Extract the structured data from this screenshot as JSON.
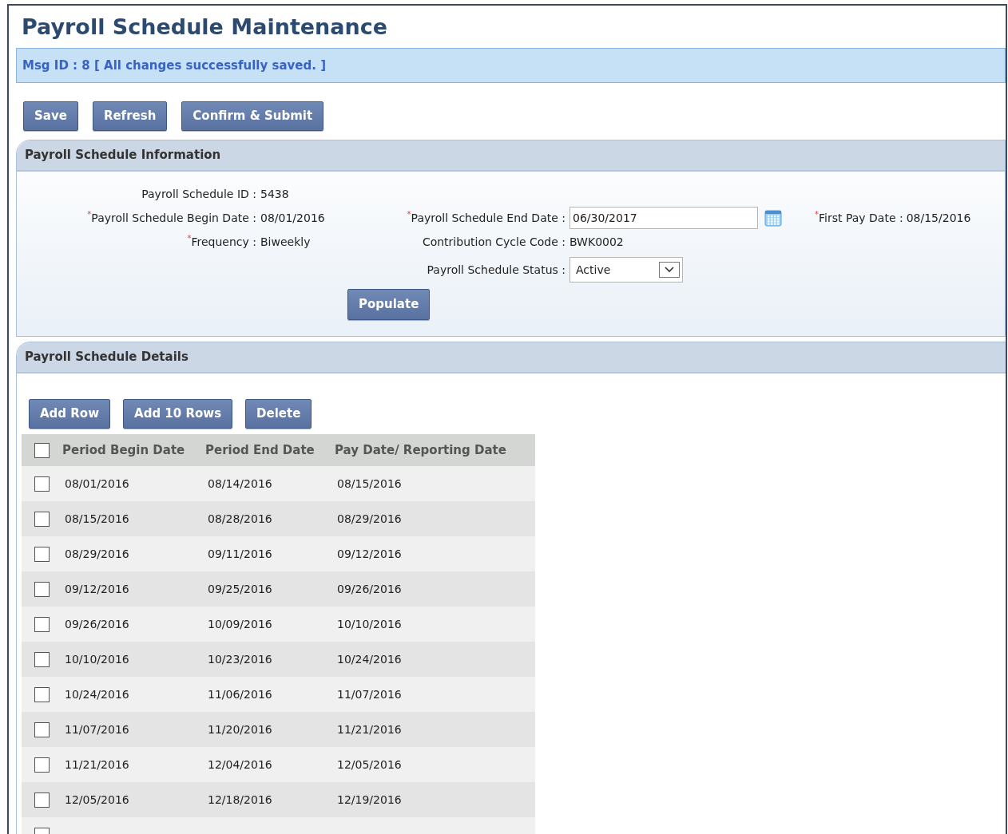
{
  "title": "Payroll Schedule Maintenance",
  "message": "Msg ID : 8 [ All changes successfully saved. ]",
  "toolbar": [
    "Save",
    "Refresh",
    "Confirm & Submit"
  ],
  "info_section": {
    "title": "Payroll Schedule Information",
    "fields": [
      {
        "kind": "text",
        "label": "Payroll Schedule ID :",
        "value": "5438"
      },
      {
        "kind": "text",
        "required_marker": "*",
        "label": "Payroll Schedule Begin Date :",
        "value": "08/01/2016"
      },
      {
        "kind": "date",
        "required_marker": "*",
        "label": "Payroll Schedule End Date :",
        "value": "06/30/2017"
      },
      {
        "kind": "text",
        "required_marker": "*",
        "label": "First Pay Date :",
        "value": "08/15/2016"
      },
      {
        "kind": "text",
        "required_marker": "*",
        "label": "Frequency :",
        "value": "Biweekly"
      },
      {
        "kind": "text",
        "label": "Contribution Cycle Code :",
        "value": "BWK0002"
      },
      {
        "kind": "select",
        "label": "Payroll Schedule Status :",
        "value": "Active"
      }
    ],
    "button": "Populate"
  },
  "details_section": {
    "title": "Payroll Schedule Details",
    "buttons": [
      "Add Row",
      "Add 10 Rows",
      "Delete"
    ],
    "table": {
      "select_all_checked": false,
      "columns": [
        "Period Begin Date",
        "Period End Date",
        "Pay Date/ Reporting Date"
      ],
      "rows": [
        {
          "checked": false,
          "cells": [
            "08/01/2016",
            "08/14/2016",
            "08/15/2016"
          ]
        },
        {
          "checked": false,
          "cells": [
            "08/15/2016",
            "08/28/2016",
            "08/29/2016"
          ]
        },
        {
          "checked": false,
          "cells": [
            "08/29/2016",
            "09/11/2016",
            "09/12/2016"
          ]
        },
        {
          "checked": false,
          "cells": [
            "09/12/2016",
            "09/25/2016",
            "09/26/2016"
          ]
        },
        {
          "checked": false,
          "cells": [
            "09/26/2016",
            "10/09/2016",
            "10/10/2016"
          ]
        },
        {
          "checked": false,
          "cells": [
            "10/10/2016",
            "10/23/2016",
            "10/24/2016"
          ]
        },
        {
          "checked": false,
          "cells": [
            "10/24/2016",
            "11/06/2016",
            "11/07/2016"
          ]
        },
        {
          "checked": false,
          "cells": [
            "11/07/2016",
            "11/20/2016",
            "11/21/2016"
          ]
        },
        {
          "checked": false,
          "cells": [
            "11/21/2016",
            "12/04/2016",
            "12/05/2016"
          ]
        },
        {
          "checked": false,
          "cells": [
            "12/05/2016",
            "12/18/2016",
            "12/19/2016"
          ]
        },
        {
          "checked": false,
          "cells": []
        }
      ]
    }
  }
}
